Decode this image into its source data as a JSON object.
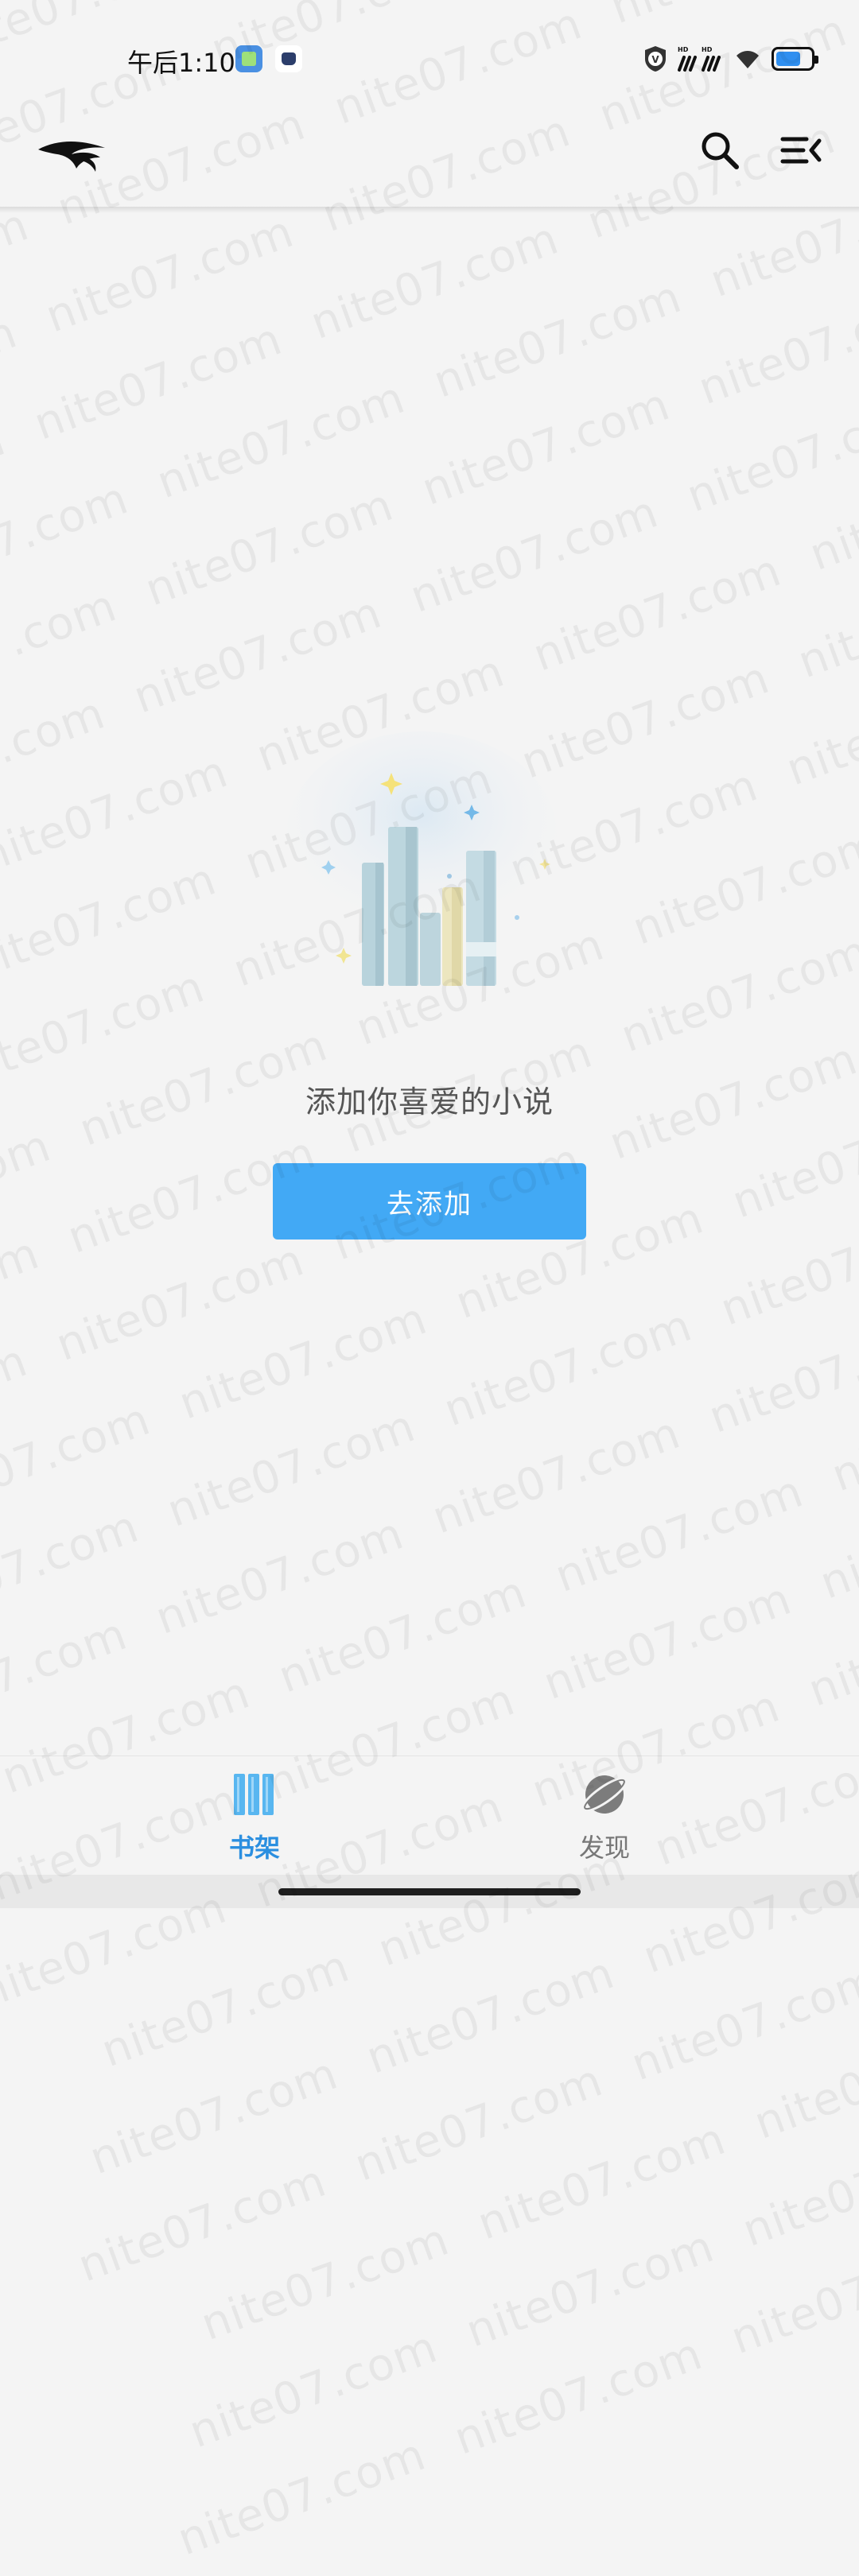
{
  "status_bar": {
    "time": "午后1:10",
    "battery_level": 0.6
  },
  "header": {
    "search_icon": "search-icon",
    "menu_icon": "menu-collapse-icon",
    "logo_icon": "bird-logo-icon"
  },
  "empty_state": {
    "message": "添加你喜爱的小说",
    "button_label": "去添加",
    "illustration": "books-illustration"
  },
  "bottom_nav": {
    "items": [
      {
        "label": "书架",
        "icon": "bookshelf-icon",
        "active": true
      },
      {
        "label": "发现",
        "icon": "planet-icon",
        "active": false
      }
    ]
  },
  "watermark": "nite07.com",
  "colors": {
    "accent": "#42a9f5",
    "active_tab": "#2b8fe0",
    "background": "#f4f4f4"
  }
}
